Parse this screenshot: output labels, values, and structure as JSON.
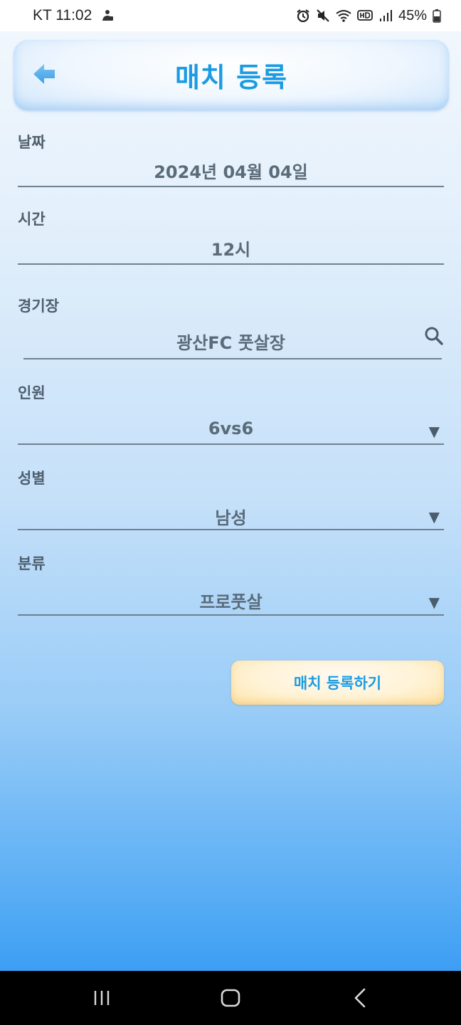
{
  "status_bar": {
    "carrier_time": "KT 11:02",
    "battery": "45%",
    "icons": [
      "notification-icon",
      "alarm-icon",
      "mute-icon",
      "wifi-icon",
      "hd-icon",
      "signal-icon",
      "battery-icon"
    ]
  },
  "header": {
    "title": "매치 등록",
    "back_icon": "back-arrow-icon",
    "accent_color": "#1a9be3"
  },
  "form": {
    "date": {
      "label": "날짜",
      "value": "2024년 04월 04일"
    },
    "time": {
      "label": "시간",
      "value": "12시"
    },
    "stadium": {
      "label": "경기장",
      "value": "광산FC 풋살장",
      "icon": "search-icon"
    },
    "players": {
      "label": "인원",
      "value": "6vs6"
    },
    "gender": {
      "label": "성별",
      "value": "남성"
    },
    "category": {
      "label": "분류",
      "value": "프로풋살"
    },
    "dropdown_glyph": "▼"
  },
  "submit": {
    "label": "매치 등록하기"
  },
  "nav_bar": {
    "icons": [
      "recent-apps-icon",
      "home-icon",
      "back-icon"
    ]
  }
}
